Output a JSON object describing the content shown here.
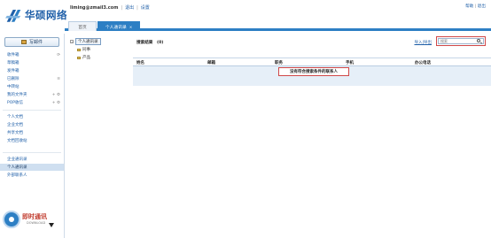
{
  "brand": {
    "name": "华硕网络"
  },
  "userbar": {
    "email": "liming@zmail3.com",
    "sep1": "|",
    "logout": "退出",
    "sep2": "|",
    "settings": "设置"
  },
  "help": {
    "help": "帮助",
    "sep": "|",
    "exit": "退出"
  },
  "tabs": {
    "home": "首页",
    "active": "个人通讯录",
    "close": "×"
  },
  "sidebar": {
    "compose": "写邮件",
    "items": [
      {
        "label": "收件箱",
        "right": "⟳"
      },
      {
        "label": "草稿箱",
        "right": ""
      },
      {
        "label": "发件箱",
        "right": ""
      },
      {
        "label": "已删除",
        "right": "≡"
      },
      {
        "label": "中转站",
        "right": ""
      },
      {
        "label": "我的文件夹",
        "right": "+ ⚙"
      },
      {
        "label": "POP收信",
        "right": "+ ⚙"
      },
      {
        "label": "个人文档",
        "right": ""
      },
      {
        "label": "企业文档",
        "right": ""
      },
      {
        "label": "共享文档",
        "right": ""
      },
      {
        "label": "文档回收站",
        "right": ""
      },
      {
        "label": "企业通讯录",
        "right": ""
      },
      {
        "label": "个人通讯录",
        "right": ""
      },
      {
        "label": "外部联系人",
        "right": ""
      }
    ],
    "im": {
      "label": "即时通讯",
      "sub": "DOWNLOAD"
    }
  },
  "tree": {
    "root": "个人通讯录",
    "children": [
      "同事",
      "产品"
    ]
  },
  "main": {
    "result": "搜索结果　(0)",
    "impexp": "导入|导出",
    "search_placeholder": "搜索",
    "columns": [
      "姓名",
      "邮箱",
      "职务",
      "手机",
      "办公电话"
    ],
    "empty": "没有符合搜索条件的联系人"
  },
  "colors": {
    "brand": "#1f5fa8",
    "accent": "#2d7fc4",
    "highlight": "#d04848"
  }
}
